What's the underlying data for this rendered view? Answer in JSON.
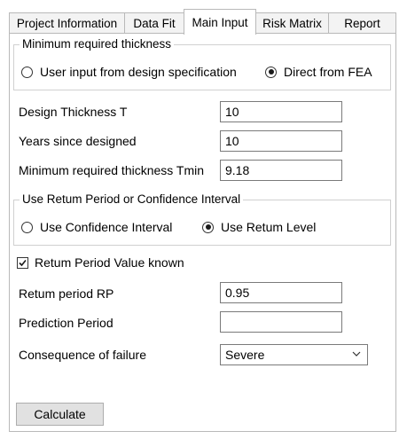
{
  "tabs": [
    {
      "label": "Project Information",
      "active": false
    },
    {
      "label": "Data Fit",
      "active": false
    },
    {
      "label": "Main Input",
      "active": true
    },
    {
      "label": "Risk Matrix",
      "active": false
    },
    {
      "label": "Report",
      "active": false
    }
  ],
  "min_thickness_group": {
    "title": "Minimum required thickness",
    "options": [
      {
        "label": "User input from design specification",
        "selected": false
      },
      {
        "label": "Direct from FEA",
        "selected": true
      }
    ]
  },
  "fields": {
    "design_thickness": {
      "label": "Design Thickness T",
      "value": "10"
    },
    "years_since_designed": {
      "label": "Years since designed",
      "value": "10"
    },
    "min_thickness_tmin": {
      "label": "Minimum required thickness Tmin",
      "value": "9.18"
    }
  },
  "return_period_group": {
    "title": "Use Retum Period or Confidence Interval",
    "options": [
      {
        "label": "Use Confidence Interval",
        "selected": false
      },
      {
        "label": "Use Retum Level",
        "selected": true
      }
    ]
  },
  "return_period_known": {
    "label": "Retum Period Value known",
    "checked": true
  },
  "return_period_rp": {
    "label": "Retum period RP",
    "value": "0.95"
  },
  "prediction_period": {
    "label": "Prediction Period",
    "value": ""
  },
  "consequence": {
    "label": "Consequence of failure",
    "selected": "Severe"
  },
  "calculate_label": "Calculate"
}
